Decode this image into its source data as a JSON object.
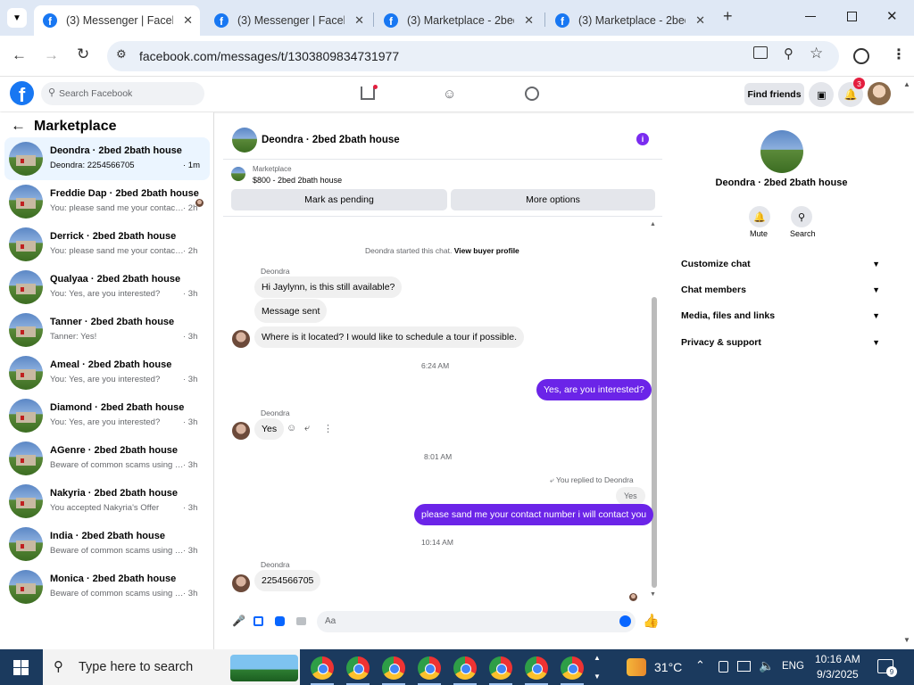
{
  "browser": {
    "tabs": [
      {
        "title": "(3) Messenger | Facebook",
        "active": true
      },
      {
        "title": "(3) Messenger | Facebook",
        "active": false
      },
      {
        "title": "(3) Marketplace - 2bed",
        "active": false
      },
      {
        "title": "(3) Marketplace - 2bed",
        "active": false
      }
    ],
    "url": "facebook.com/messages/t/1303809834731977"
  },
  "fb_header": {
    "search_placeholder": "Search Facebook",
    "find_friends": "Find friends",
    "notification_count": "3"
  },
  "left": {
    "title": "Marketplace",
    "chats": [
      {
        "name": "Deondra · 2bed 2bath house",
        "preview": "Deondra: 2254566705",
        "time": "· 1m",
        "selected": true
      },
      {
        "name": "Freddie Dap · 2bed 2bath house",
        "preview": "You: please sand me your contact n...",
        "time": "· 2h"
      },
      {
        "name": "Derrick · 2bed 2bath house",
        "preview": "You: please sand me your contact nu...",
        "time": "· 2h"
      },
      {
        "name": "Qualyaa · 2bed 2bath house",
        "preview": "You: Yes, are you interested?",
        "time": "· 3h"
      },
      {
        "name": "Tanner · 2bed 2bath house",
        "preview": "Tanner: Yes!",
        "time": "· 3h"
      },
      {
        "name": "Ameal · 2bed 2bath house",
        "preview": "You: Yes, are you interested?",
        "time": "· 3h"
      },
      {
        "name": "Diamond · 2bed 2bath house",
        "preview": "You: Yes, are you interested?",
        "time": "· 3h"
      },
      {
        "name": "AGenre · 2bed 2bath house",
        "preview": "Beware of common scams using pay...",
        "time": "· 3h"
      },
      {
        "name": "Nakyria · 2bed 2bath house",
        "preview": "You accepted Nakyria's Offer",
        "time": "· 3h"
      },
      {
        "name": "India · 2bed 2bath house",
        "preview": "Beware of common scams using pay...",
        "time": "· 3h"
      },
      {
        "name": "Monica · 2bed 2bath house",
        "preview": "Beware of common scams using pay...",
        "time": "· 3h"
      }
    ]
  },
  "conversation": {
    "title": "Deondra · 2bed 2bath house",
    "listing_label": "Marketplace",
    "listing_price": "$800 - 2bed 2bath house",
    "mark_pending": "Mark as pending",
    "more_options": "More options",
    "started_text": "Deondra started this chat.",
    "view_profile": "View buyer profile",
    "sender": "Deondra",
    "msg1": "Hi Jaylynn, is this still available?",
    "msg2": "Message sent",
    "msg3": "Where is it located? I would like to schedule a tour if possible.",
    "time1": "6:24 AM",
    "mine1": "Yes, are you interested?",
    "msg4": "Yes",
    "time2": "8:01 AM",
    "replied_to": "You replied to Deondra",
    "quoted": "Yes",
    "mine2": "please sand me your contact number i will contact you",
    "time3": "10:14 AM",
    "msg5": "2254566705",
    "compose_placeholder": "Aa"
  },
  "right": {
    "name": "Deondra · 2bed 2bath house",
    "mute": "Mute",
    "search": "Search",
    "sections": [
      "Customize chat",
      "Chat members",
      "Media, files and links",
      "Privacy & support"
    ]
  },
  "taskbar": {
    "search_placeholder": "Type here to search",
    "weather": "31°C",
    "lang": "ENG",
    "time": "10:16 AM",
    "date": "9/3/2025",
    "notif_count": "9"
  }
}
